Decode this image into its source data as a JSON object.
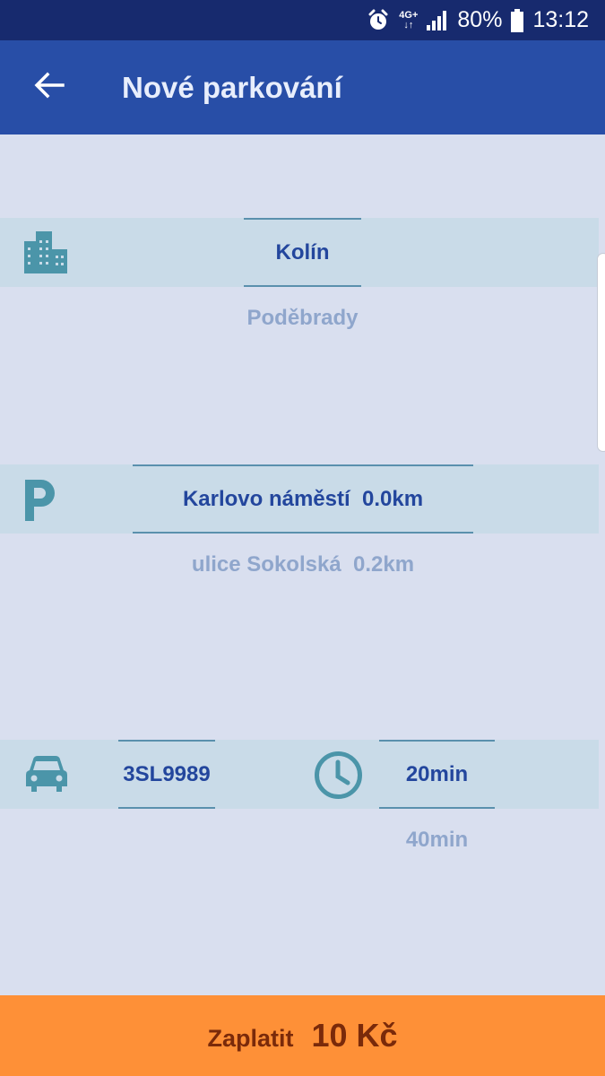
{
  "status_bar": {
    "network": "4G+",
    "battery": "80%",
    "time": "13:12",
    "icons": [
      "alarm-icon",
      "network-4g-icon",
      "signal-icon",
      "battery-icon"
    ]
  },
  "app_bar": {
    "title": "Nové parkování",
    "back_icon": "arrow-left-icon"
  },
  "city": {
    "icon": "city-building-icon",
    "selected": "Kolín",
    "next": "Poděbrady"
  },
  "zone": {
    "icon": "parking-icon",
    "selected": "Karlovo náměstí  0.0km",
    "next": "ulice Sokolská  0.2km"
  },
  "vehicle": {
    "icon": "car-icon",
    "selected": "3SL9989"
  },
  "duration": {
    "icon": "clock-icon",
    "selected": "20min",
    "next": "40min"
  },
  "pay_button": {
    "label": "Zaplatit",
    "amount": "10 Kč"
  },
  "colors": {
    "status_bar": "#172a6e",
    "app_bar": "#284ea7",
    "background": "#d9dfef",
    "band": "#c9dbe8",
    "icon_teal": "#4b95a9",
    "selected_text": "#23469d",
    "pay_button": "#fe9037"
  }
}
